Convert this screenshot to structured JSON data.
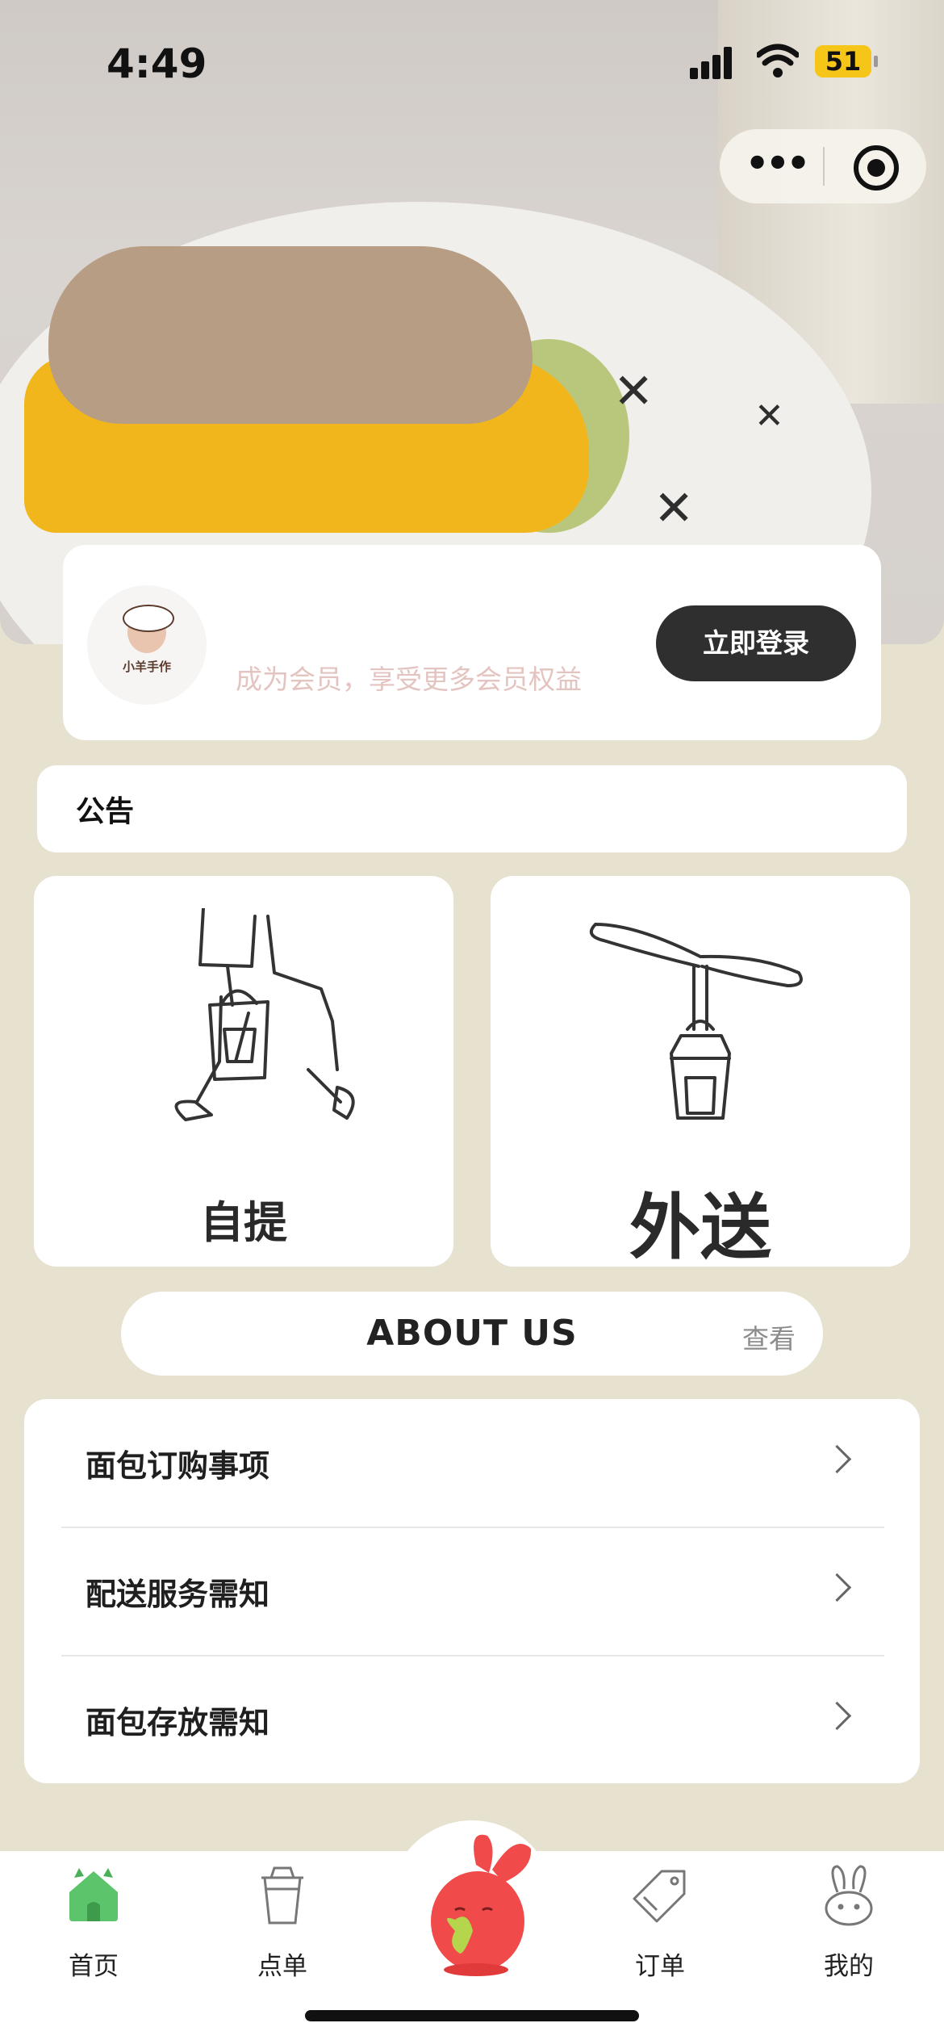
{
  "status_bar": {
    "time": "4:49",
    "battery": "51"
  },
  "member": {
    "logo_text": "小羊手作",
    "prompt": "成为会员，享受更多会员权益",
    "login_label": "立即登录"
  },
  "notice": {
    "label": "公告"
  },
  "modes": [
    {
      "label": "自提"
    },
    {
      "label": "外送"
    }
  ],
  "about": {
    "title": "ABOUT US",
    "view_label": "查看"
  },
  "list": [
    {
      "label": "面包订购事项"
    },
    {
      "label": "配送服务需知"
    },
    {
      "label": "面包存放需知"
    }
  ],
  "tabs": [
    {
      "label": "首页"
    },
    {
      "label": "点单"
    },
    {
      "label": "订单"
    },
    {
      "label": "我的"
    }
  ],
  "colors": {
    "background": "#e6e2cf",
    "button_dark": "#2f2f2f",
    "member_prompt": "#e3c4c0",
    "home_tab_icon": "#5cc46a",
    "mascot": "#f04a4a"
  }
}
